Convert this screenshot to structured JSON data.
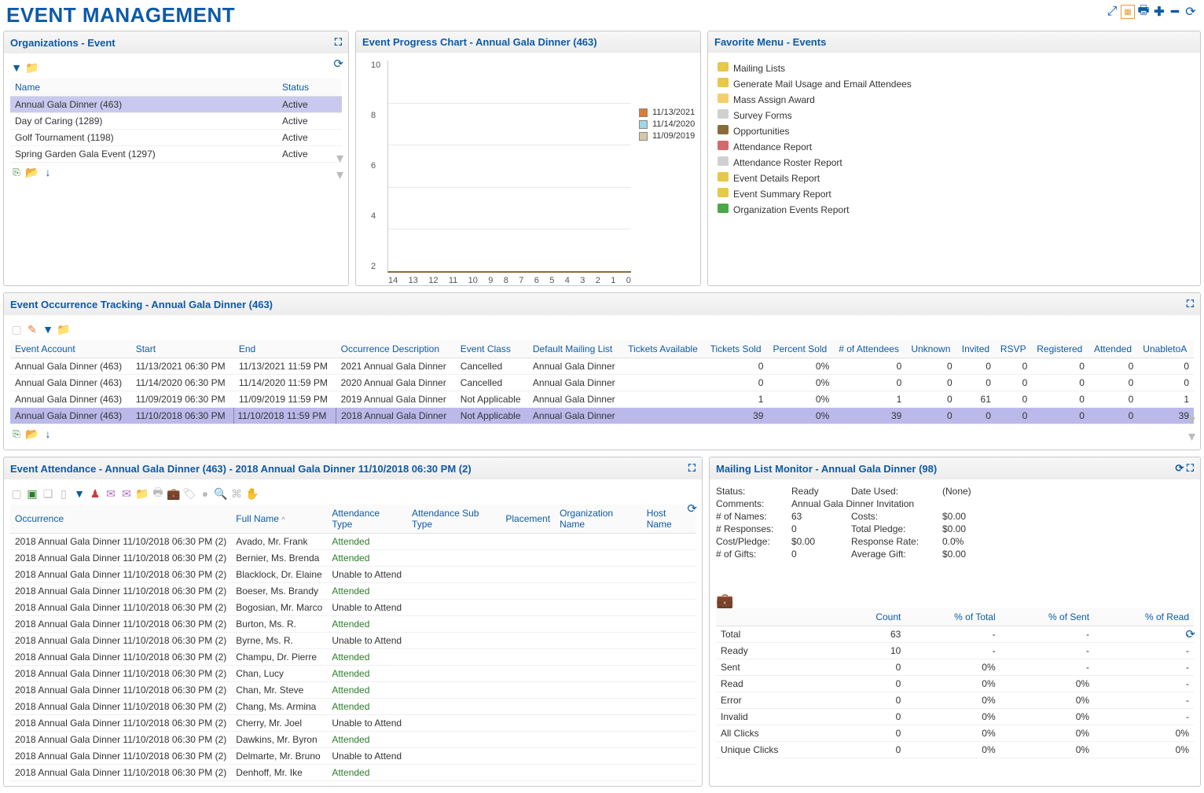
{
  "page_title": "EVENT MANAGEMENT",
  "panels": {
    "organizations": {
      "title": "Organizations - Event",
      "columns": [
        "Name",
        "Status"
      ],
      "rows": [
        {
          "name": "Annual Gala Dinner  (463)",
          "status": "Active",
          "selected": true
        },
        {
          "name": "Day of Caring  (1289)",
          "status": "Active"
        },
        {
          "name": "Golf Tournament  (1198)",
          "status": "Active"
        },
        {
          "name": "Spring Garden Gala Event  (1297)",
          "status": "Active"
        }
      ]
    },
    "chart": {
      "title": "Event Progress Chart - Annual Gala Dinner  (463)",
      "y_ticks": [
        "10",
        "8",
        "6",
        "4",
        "2"
      ],
      "x_ticks": [
        "14",
        "13",
        "12",
        "11",
        "10",
        "9",
        "8",
        "7",
        "6",
        "5",
        "4",
        "3",
        "2",
        "1",
        "0"
      ],
      "legend": [
        {
          "label": "11/13/2021",
          "color": "#e07b2e"
        },
        {
          "label": "11/14/2020",
          "color": "#9fd7e6"
        },
        {
          "label": "11/09/2019",
          "color": "#d8c6a6"
        }
      ]
    },
    "favorites": {
      "title": "Favorite Menu - Events",
      "items": [
        {
          "label": "Mailing Lists",
          "color": "#e6c84a"
        },
        {
          "label": "Generate Mail Usage and Email Attendees",
          "color": "#e6c84a"
        },
        {
          "label": "Mass Assign Award",
          "color": "#f3d06a"
        },
        {
          "label": "Survey Forms",
          "color": "#d0d0d0"
        },
        {
          "label": "Opportunities",
          "color": "#8a6b3a"
        },
        {
          "label": "Attendance Report",
          "color": "#d46a6a"
        },
        {
          "label": "Attendance Roster Report",
          "color": "#d0d0d0"
        },
        {
          "label": "Event Details Report",
          "color": "#e6c84a"
        },
        {
          "label": "Event Summary Report",
          "color": "#e6c84a"
        },
        {
          "label": "Organization Events Report",
          "color": "#4aa84a"
        }
      ]
    },
    "occurrence": {
      "title": "Event Occurrence Tracking - Annual Gala Dinner  (463)",
      "columns": [
        "Event Account",
        "Start",
        "End",
        "Occurrence Description",
        "Event Class",
        "Default Mailing List",
        "Tickets Available",
        "Tickets Sold",
        "Percent Sold",
        "# of Attendees",
        "Unknown",
        "Invited",
        "RSVP",
        "Registered",
        "Attended",
        "UnabletoA"
      ],
      "rows": [
        {
          "acct": "Annual Gala Dinner  (463)",
          "start": "11/13/2021 06:30 PM",
          "end": "11/13/2021 11:59 PM",
          "desc": "2021 Annual Gala Dinner",
          "class": "Cancelled",
          "ml": "Annual Gala Dinner",
          "ta": "",
          "ts": "0",
          "ps": "0%",
          "att": "0",
          "unk": "0",
          "inv": "0",
          "rsvp": "0",
          "reg": "0",
          "attd": "0",
          "una": "0"
        },
        {
          "acct": "Annual Gala Dinner  (463)",
          "start": "11/14/2020 06:30 PM",
          "end": "11/14/2020 11:59 PM",
          "desc": "2020 Annual Gala Dinner",
          "class": "Cancelled",
          "ml": "Annual Gala Dinner",
          "ta": "",
          "ts": "0",
          "ps": "0%",
          "att": "0",
          "unk": "0",
          "inv": "0",
          "rsvp": "0",
          "reg": "0",
          "attd": "0",
          "una": "0"
        },
        {
          "acct": "Annual Gala Dinner  (463)",
          "start": "11/09/2019 06:30 PM",
          "end": "11/09/2019 11:59 PM",
          "desc": "2019 Annual Gala Dinner",
          "class": "Not Applicable",
          "ml": "Annual Gala Dinner",
          "ta": "",
          "ts": "1",
          "ps": "0%",
          "att": "1",
          "unk": "0",
          "inv": "61",
          "rsvp": "0",
          "reg": "0",
          "attd": "0",
          "una": "1"
        },
        {
          "acct": "Annual Gala Dinner  (463)",
          "start": "11/10/2018 06:30 PM",
          "end": "11/10/2018 11:59 PM",
          "desc": "2018 Annual Gala Dinner",
          "class": "Not Applicable",
          "ml": "Annual Gala Dinner",
          "ta": "",
          "ts": "39",
          "ps": "0%",
          "att": "39",
          "unk": "0",
          "inv": "0",
          "rsvp": "0",
          "reg": "0",
          "attd": "0",
          "una": "39",
          "selected": true
        }
      ]
    },
    "attendance": {
      "title": "Event Attendance - Annual Gala Dinner  (463) - 2018 Annual Gala Dinner 11/10/2018 06:30 PM (2)",
      "columns": [
        "Occurrence",
        "Full Name",
        "Attendance Type",
        "Attendance Sub Type",
        "Placement",
        "Organization Name",
        "Host Name"
      ],
      "occurrence_value": "2018 Annual Gala Dinner 11/10/2018 06:30 PM (2)",
      "rows": [
        {
          "name": "Avado, Mr. Frank",
          "type": "Attended"
        },
        {
          "name": "Bernier, Ms. Brenda",
          "type": "Attended"
        },
        {
          "name": "Blacklock, Dr. Elaine",
          "type": "Unable to Attend"
        },
        {
          "name": "Boeser, Ms. Brandy",
          "type": "Attended"
        },
        {
          "name": "Bogosian, Mr. Marco",
          "type": "Unable to Attend"
        },
        {
          "name": "Burton, Ms. R.",
          "type": "Attended"
        },
        {
          "name": "Byrne, Ms. R.",
          "type": "Unable to Attend"
        },
        {
          "name": "Champu, Dr. Pierre",
          "type": "Attended"
        },
        {
          "name": "Chan, Lucy",
          "type": "Attended"
        },
        {
          "name": "Chan, Mr. Steve",
          "type": "Attended"
        },
        {
          "name": "Chang, Ms. Armina",
          "type": "Attended"
        },
        {
          "name": "Cherry, Mr. Joel",
          "type": "Unable to Attend"
        },
        {
          "name": "Dawkins, Mr. Byron",
          "type": "Attended"
        },
        {
          "name": "Delmarte, Mr. Bruno",
          "type": "Unable to Attend"
        },
        {
          "name": "Denhoff, Mr. Ike",
          "type": "Attended"
        }
      ]
    },
    "mailing": {
      "title": "Mailing List Monitor - Annual Gala Dinner (98)",
      "stats": {
        "status_label": "Status:",
        "status": "Ready",
        "date_used_label": "Date Used:",
        "date_used": "(None)",
        "comments_label": "Comments:",
        "comments": "Annual Gala Dinner Invitation",
        "names_label": "# of Names:",
        "names": "63",
        "costs_label": "Costs:",
        "costs": "$0.00",
        "responses_label": "# Responses:",
        "responses": "0",
        "pledge_label": "Total Pledge:",
        "pledge": "$0.00",
        "costpledge_label": "Cost/Pledge:",
        "costpledge": "$0.00",
        "resprate_label": "Response Rate:",
        "resprate": "0.0%",
        "gifts_label": "# of Gifts:",
        "gifts": "0",
        "avggift_label": "Average Gift:",
        "avggift": "$0.00"
      },
      "columns": [
        "",
        "Count",
        "% of Total",
        "% of Sent",
        "% of Read"
      ],
      "rows": [
        {
          "label": "Total",
          "count": "63",
          "tot": "-",
          "sent": "-",
          "read": "-"
        },
        {
          "label": "Ready",
          "count": "10",
          "tot": "-",
          "sent": "-",
          "read": "-"
        },
        {
          "label": "Sent",
          "count": "0",
          "tot": "0%",
          "sent": "-",
          "read": "-"
        },
        {
          "label": "Read",
          "count": "0",
          "tot": "0%",
          "sent": "0%",
          "read": "-"
        },
        {
          "label": "Error",
          "count": "0",
          "tot": "0%",
          "sent": "0%",
          "read": "-"
        },
        {
          "label": "Invalid",
          "count": "0",
          "tot": "0%",
          "sent": "0%",
          "read": "-"
        },
        {
          "label": "All Clicks",
          "count": "0",
          "tot": "0%",
          "sent": "0%",
          "read": "0%"
        },
        {
          "label": "Unique Clicks",
          "count": "0",
          "tot": "0%",
          "sent": "0%",
          "read": "0%"
        }
      ]
    }
  },
  "chart_data": {
    "type": "line",
    "title": "Event Progress Chart - Annual Gala Dinner (463)",
    "xlabel": "",
    "ylabel": "",
    "x": [
      14,
      13,
      12,
      11,
      10,
      9,
      8,
      7,
      6,
      5,
      4,
      3,
      2,
      1,
      0
    ],
    "ylim": [
      0,
      10
    ],
    "series": [
      {
        "name": "11/13/2021",
        "values": [
          0,
          0,
          0,
          0,
          0,
          0,
          0,
          0,
          0,
          0,
          0,
          0,
          0,
          0,
          0
        ]
      },
      {
        "name": "11/14/2020",
        "values": [
          0,
          0,
          0,
          0,
          0,
          0,
          0,
          0,
          0,
          0,
          0,
          0,
          0,
          0,
          0
        ]
      },
      {
        "name": "11/09/2019",
        "values": [
          0,
          0,
          0,
          0,
          0,
          0,
          0,
          0,
          0,
          0,
          0,
          0,
          0,
          0,
          0
        ]
      }
    ]
  }
}
